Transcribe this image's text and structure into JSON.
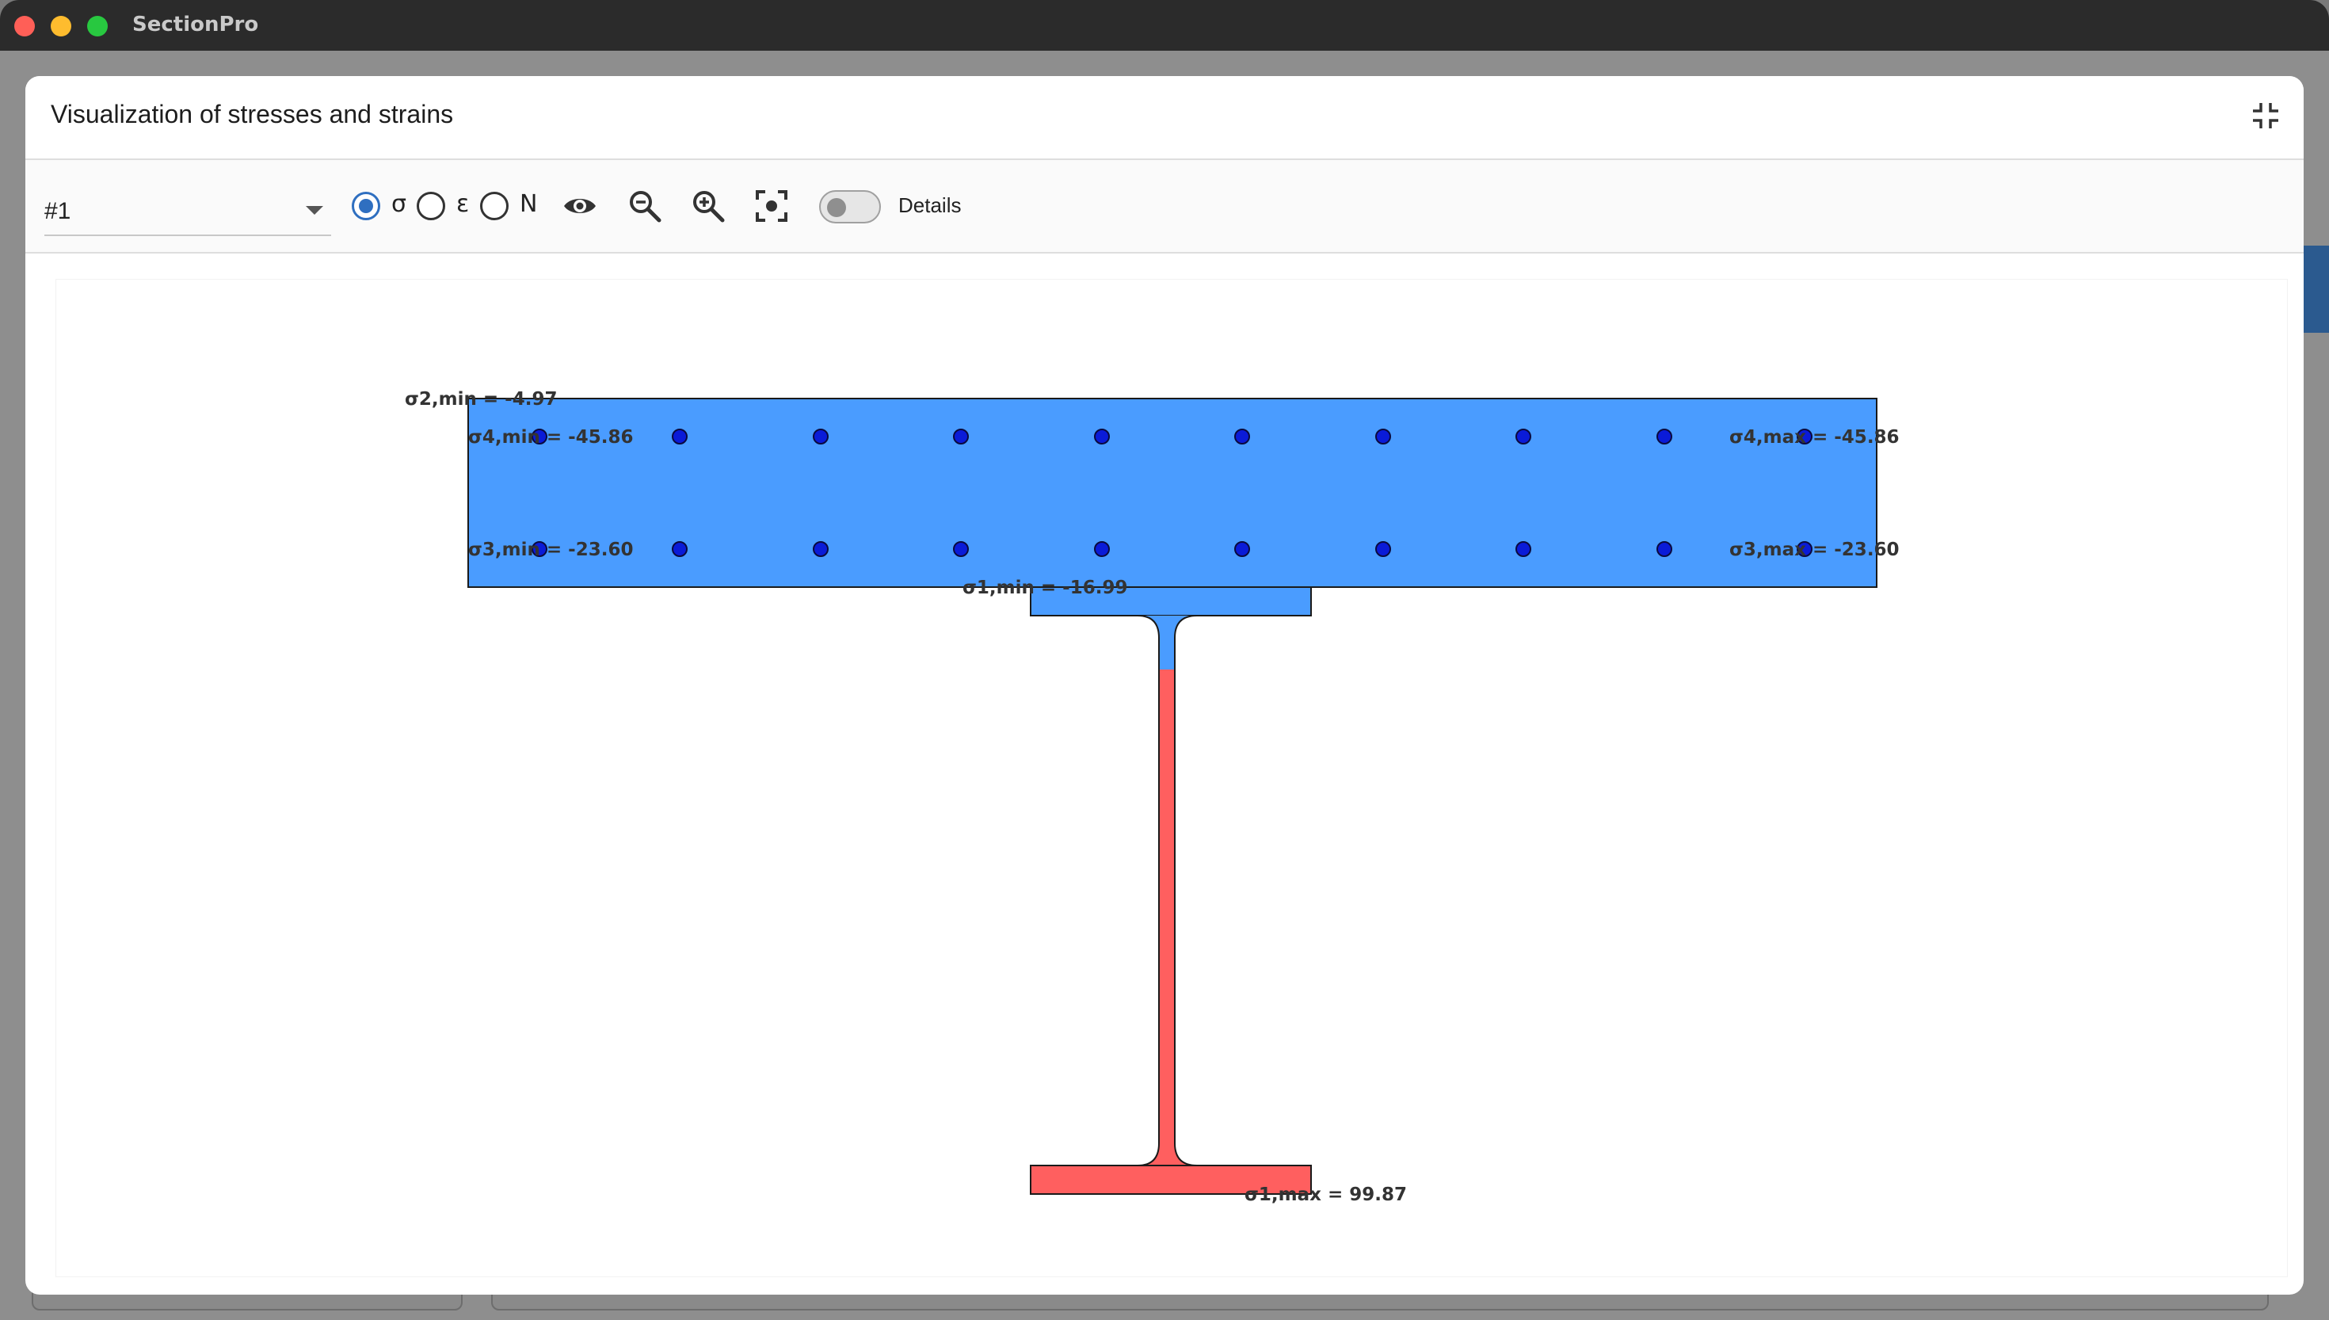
{
  "window": {
    "title": "SectionPro"
  },
  "dialog": {
    "title": "Visualization of stresses and strains"
  },
  "toolbar": {
    "section_select": "#1",
    "radios": [
      {
        "label": "σ",
        "checked": true
      },
      {
        "label": "ε",
        "checked": false
      },
      {
        "label": "N",
        "checked": false
      }
    ],
    "details_label": "Details",
    "details_on": false
  },
  "colors": {
    "compression": "#4a9cff",
    "tension": "#ff5f5f",
    "rebar": "#0a1bd8",
    "outline": "#1a1a1a"
  },
  "icons": [
    "eye-icon",
    "zoom-out-icon",
    "zoom-in-icon",
    "fit-view-icon",
    "collapse-icon"
  ],
  "annotations": {
    "s2_min": "σ2,min = -4.97",
    "s4_min": "σ4,min = -45.86",
    "s4_max": "σ4,max = -45.86",
    "s3_min": "σ3,min = -23.60",
    "s3_max": "σ3,max = -23.60",
    "s1_min": "σ1,min = -16.99",
    "s1_max": "σ1,max = 99.87"
  }
}
